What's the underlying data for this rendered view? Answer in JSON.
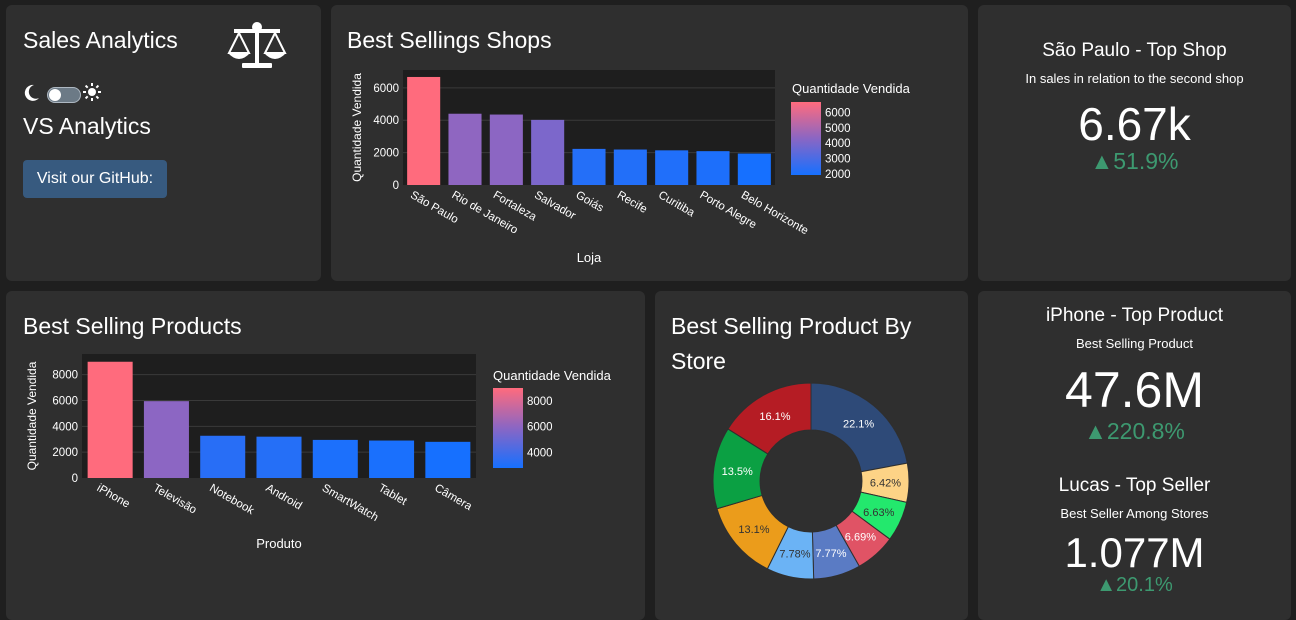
{
  "brand": {
    "title": "Sales Analytics",
    "subtitle": "VS Analytics",
    "github_button": "Visit our GitHub:",
    "icon": "balance-scale-icon",
    "theme_toggle_on": false
  },
  "shops_card": {
    "title": "Best Sellings Shops"
  },
  "products_card": {
    "title": "Best Selling Products"
  },
  "donut_card": {
    "title_line1": "Best Selling Product By",
    "title_line2": "Store"
  },
  "top_shop": {
    "title": "São Paulo - Top Shop",
    "subtitle": "In sales in relation to the second shop",
    "value": "6.67k",
    "delta": "▲51.9%"
  },
  "top_product": {
    "title": "iPhone - Top Product",
    "subtitle": "Best Selling Product",
    "value": "47.6M",
    "delta": "▲220.8%"
  },
  "top_seller": {
    "title": "Lucas - Top Seller",
    "subtitle": "Best Seller Among Stores",
    "value": "1.077M",
    "delta": "▲20.1%"
  },
  "colors": {
    "card_bg": "#2f2f2f",
    "page_bg": "#1f1f1f",
    "plot_bg": "#1e1e1e",
    "accent_button": "#375a7f",
    "delta_green": "#3d9970",
    "scale_high": "#ff6b7d",
    "scale_mid": "#8a66c4",
    "scale_low": "#1670ff"
  },
  "chart_data": [
    {
      "id": "shops",
      "type": "bar",
      "categories": [
        "São Paulo",
        "Rio de Janeiro",
        "Fortaleza",
        "Salvador",
        "Goiás",
        "Recife",
        "Curitiba",
        "Porto Alegre",
        "Belo Horizonte"
      ],
      "values": [
        6670,
        4400,
        4350,
        4020,
        2230,
        2190,
        2140,
        2090,
        1940
      ],
      "xlabel": "Loja",
      "ylabel": "Quantidade Vendida",
      "ylim": [
        0,
        7100
      ],
      "yticks": [
        0,
        2000,
        4000,
        6000
      ],
      "colorbar": {
        "title": "Quantidade Vendida",
        "ticks": [
          2000,
          3000,
          4000,
          5000,
          6000
        ],
        "range": [
          1940,
          6670
        ]
      }
    },
    {
      "id": "products",
      "type": "bar",
      "categories": [
        "iPhone",
        "Televisão",
        "Notebook",
        "Android",
        "SmartWatch",
        "Tablet",
        "Câmera"
      ],
      "values": [
        9000,
        5950,
        3270,
        3200,
        2950,
        2900,
        2800
      ],
      "xlabel": "Produto",
      "ylabel": "Quantidade Vendida",
      "ylim": [
        0,
        9600
      ],
      "yticks": [
        0,
        2000,
        4000,
        6000,
        8000
      ],
      "colorbar": {
        "title": "Quantidade Vendida",
        "ticks": [
          4000,
          6000,
          8000
        ],
        "range": [
          2800,
          9000
        ]
      }
    },
    {
      "id": "donut",
      "type": "pie",
      "hole": 0.52,
      "slices": [
        {
          "label": "22.1%",
          "value": 22.1,
          "color": "#2e4a78",
          "text_color": "#ffffff"
        },
        {
          "label": "6.42%",
          "value": 6.42,
          "color": "#fdd386",
          "text_color": "#333333"
        },
        {
          "label": "6.63%",
          "value": 6.63,
          "color": "#23e86d",
          "text_color": "#333333"
        },
        {
          "label": "6.69%",
          "value": 6.69,
          "color": "#e05365",
          "text_color": "#ffffff"
        },
        {
          "label": "7.77%",
          "value": 7.77,
          "color": "#5a7bc4",
          "text_color": "#ffffff"
        },
        {
          "label": "7.78%",
          "value": 7.78,
          "color": "#6bb3f5",
          "text_color": "#333333"
        },
        {
          "label": "13.1%",
          "value": 13.1,
          "color": "#eb9c1b",
          "text_color": "#333333"
        },
        {
          "label": "13.5%",
          "value": 13.5,
          "color": "#0ba043",
          "text_color": "#ffffff"
        },
        {
          "label": "16.1%",
          "value": 16.1,
          "color": "#b51c24",
          "text_color": "#ffffff"
        }
      ]
    }
  ]
}
